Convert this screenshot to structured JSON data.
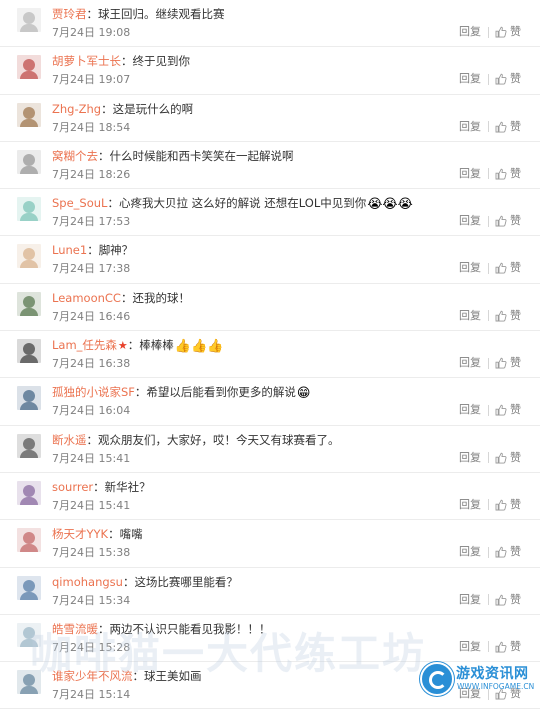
{
  "labels": {
    "reply": "回复",
    "like": "赞",
    "colon": "："
  },
  "colors": {
    "username": "#eb7350",
    "text": "#333333",
    "meta": "#808080",
    "brand": "#2a8fd6"
  },
  "comments": [
    {
      "user": "贾玲君",
      "text": "球王回归。继续观看比赛",
      "time": "7月24日 19:08",
      "avatar_color": "#b9b9b9"
    },
    {
      "user": "胡萝卜军士长",
      "text": "终于见到你",
      "time": "7月24日 19:07",
      "avatar_color": "#c0504d"
    },
    {
      "user": "Zhg-Zhg",
      "text": "这是玩什么的啊",
      "time": "7月24日 18:54",
      "avatar_color": "#a07850"
    },
    {
      "user": "窝糊个去",
      "text": "什么时候能和西卡笑笑在一起解说啊",
      "time": "7月24日 18:26",
      "avatar_color": "#9a9a9a"
    },
    {
      "user": "Spe_SouL",
      "text": "心疼我大贝拉 这么好的解说 还想在LOL中见到你",
      "time": "7月24日 17:53",
      "avatar_color": "#7fc6b8",
      "emoji": "😭😭😭"
    },
    {
      "user": "Lune1",
      "text": "脚神？",
      "time": "7月24日 17:38",
      "avatar_color": "#d9b48f"
    },
    {
      "user": "LeamoonCC",
      "text": "还我的球！",
      "time": "7月24日 16:46",
      "avatar_color": "#5a7a52"
    },
    {
      "user": "Lam_任先森",
      "text": "棒棒棒",
      "time": "7月24日 16:38",
      "avatar_color": "#444444",
      "emoji": "👍👍👍",
      "vip": "★"
    },
    {
      "user": "孤独的小说家SF",
      "text": "希望以后能看到你更多的解说",
      "time": "7月24日 16:04",
      "avatar_color": "#4a6a8a",
      "emoji": "😁"
    },
    {
      "user": "断水遥",
      "text": "观众朋友们，大家好，哎！今天又有球赛看了。",
      "time": "7月24日 15:41",
      "avatar_color": "#5a5a5a"
    },
    {
      "user": "sourrer",
      "text": "新华社？",
      "time": "7月24日 15:41",
      "avatar_color": "#8a6aa0"
    },
    {
      "user": "杨天才YYK",
      "text": "嘴嘴",
      "time": "7月24日 15:38",
      "avatar_color": "#c46a6a"
    },
    {
      "user": "qimohangsu",
      "text": "这场比赛哪里能看？",
      "time": "7月24日 15:34",
      "avatar_color": "#5a7fa8"
    },
    {
      "user": "皓雪流暖",
      "text": "两边不认识只能看见我影！！！",
      "time": "7月24日 15:28",
      "avatar_color": "#9fb8c8"
    },
    {
      "user": "谁家少年不风流",
      "text": "球王美如画",
      "time": "7月24日 15:14",
      "avatar_color": "#6a8aa0"
    }
  ],
  "watermark": {
    "text": "咖啡猫一大代练工坊"
  },
  "brand": {
    "name": "游戏资讯网",
    "url": "WWW.INFOGAME.CN"
  }
}
